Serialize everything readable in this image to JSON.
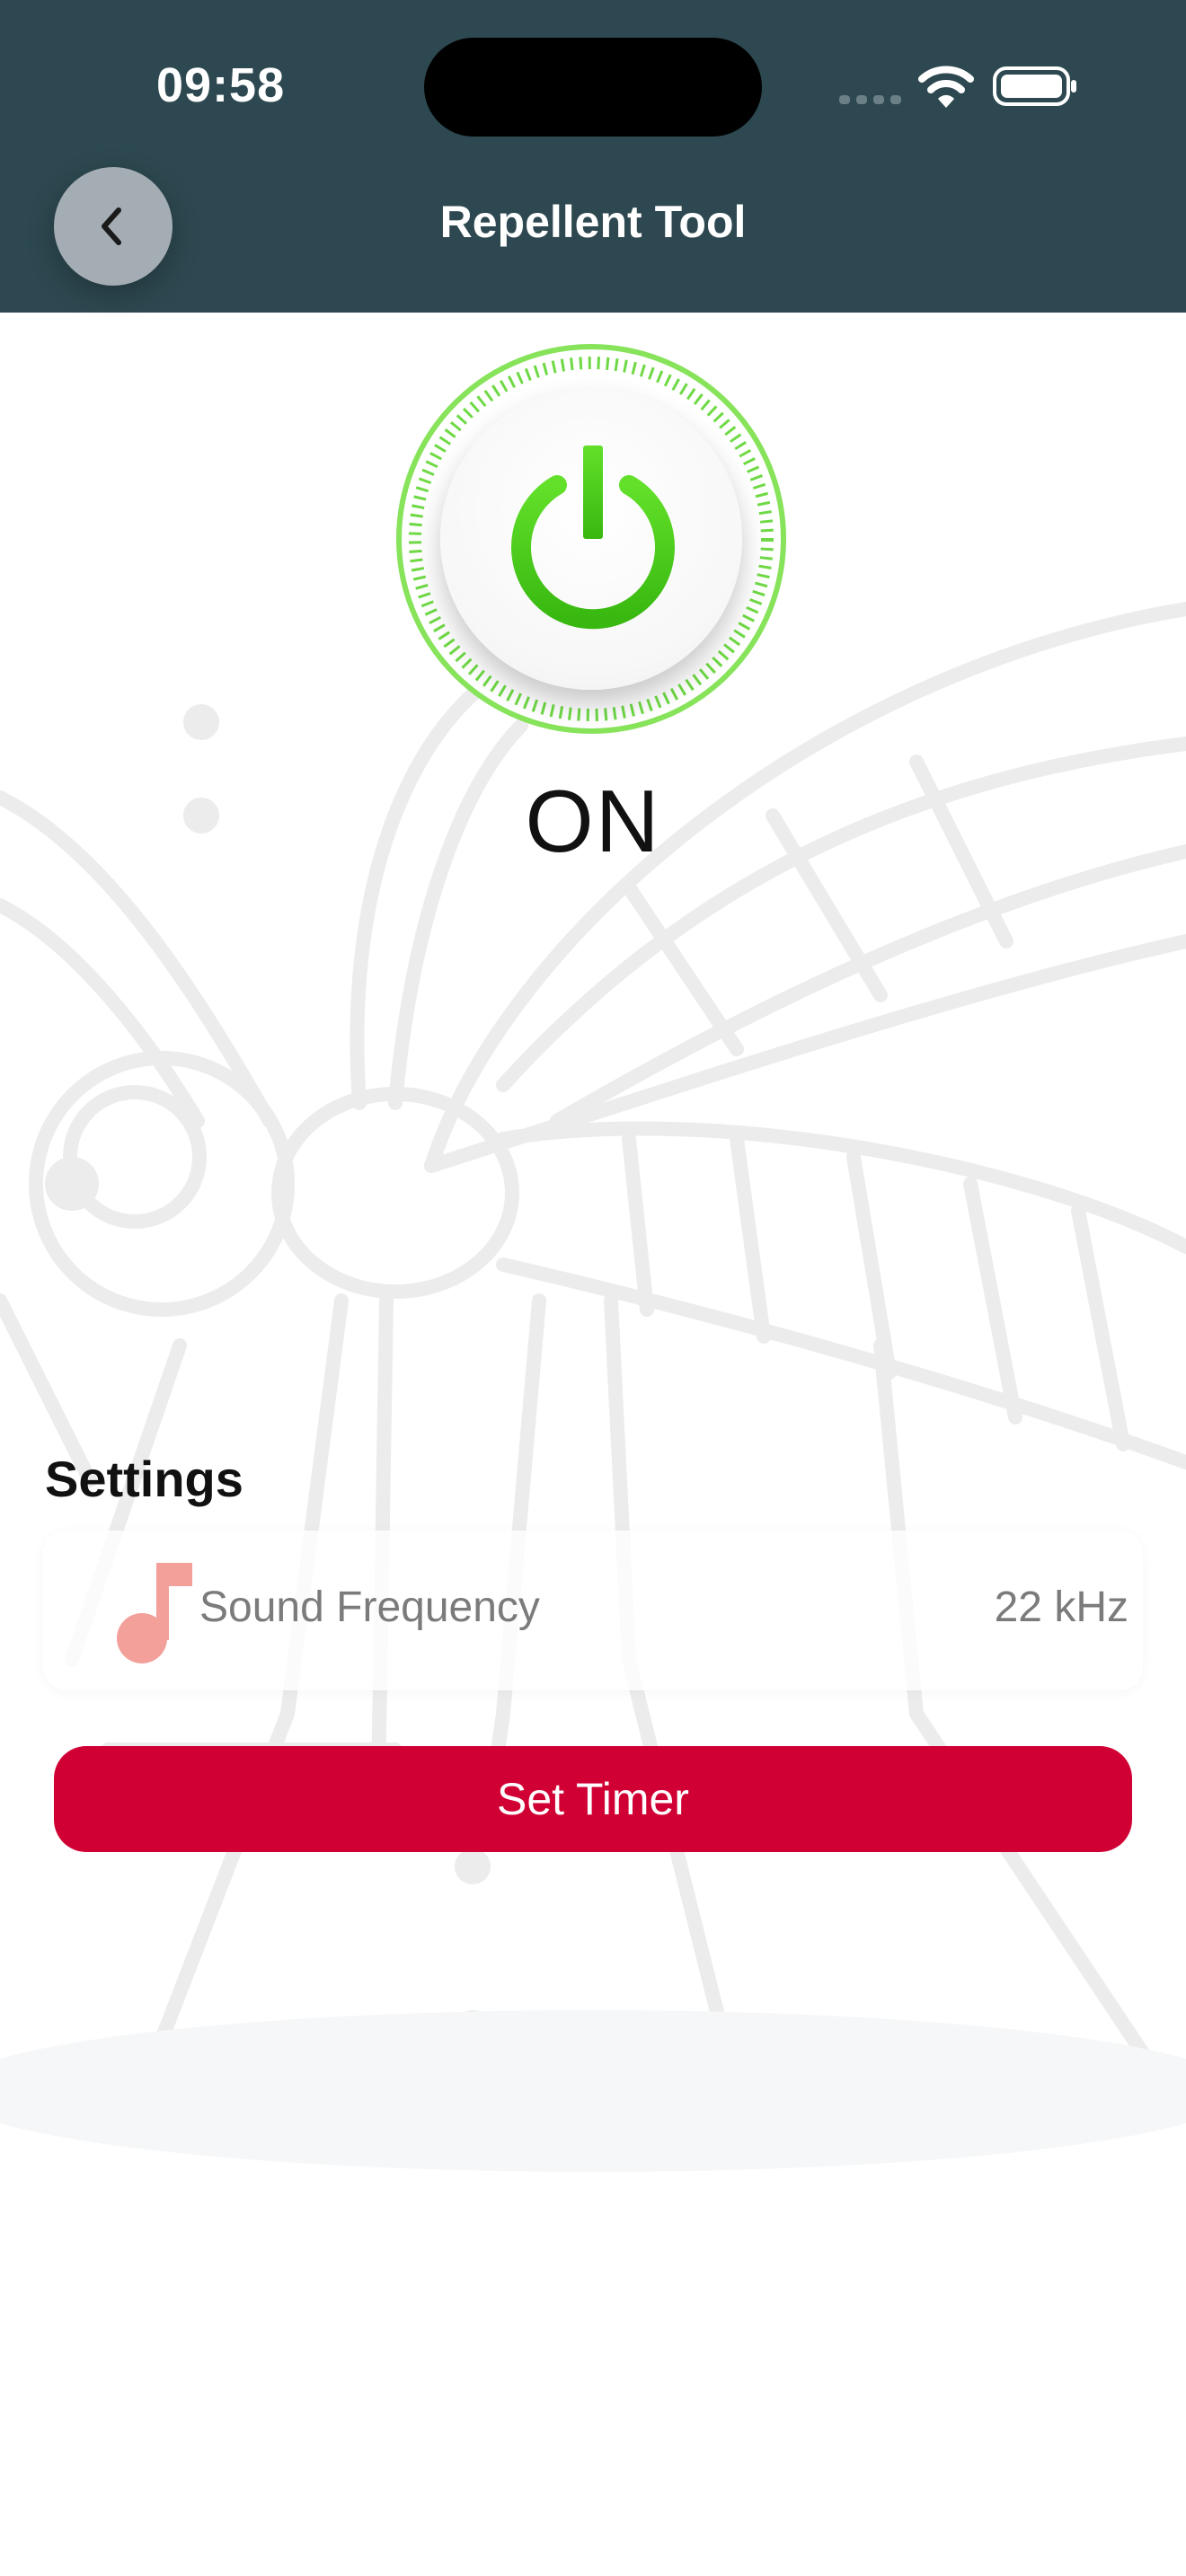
{
  "status_bar": {
    "time": "09:58"
  },
  "header": {
    "title": "Repellent Tool"
  },
  "repellent": {
    "state": "ON"
  },
  "settings": {
    "title": "Settings",
    "items": [
      {
        "label": "Sound Frequency",
        "value": "22 kHz",
        "icon": "music-note-icon"
      }
    ]
  },
  "actions": {
    "timer_label": "Set Timer"
  },
  "colors": {
    "header_bg": "#2d4850",
    "accent_green": "#4cd41e",
    "button_red": "#d10034",
    "note_pink": "#f3a09b"
  }
}
